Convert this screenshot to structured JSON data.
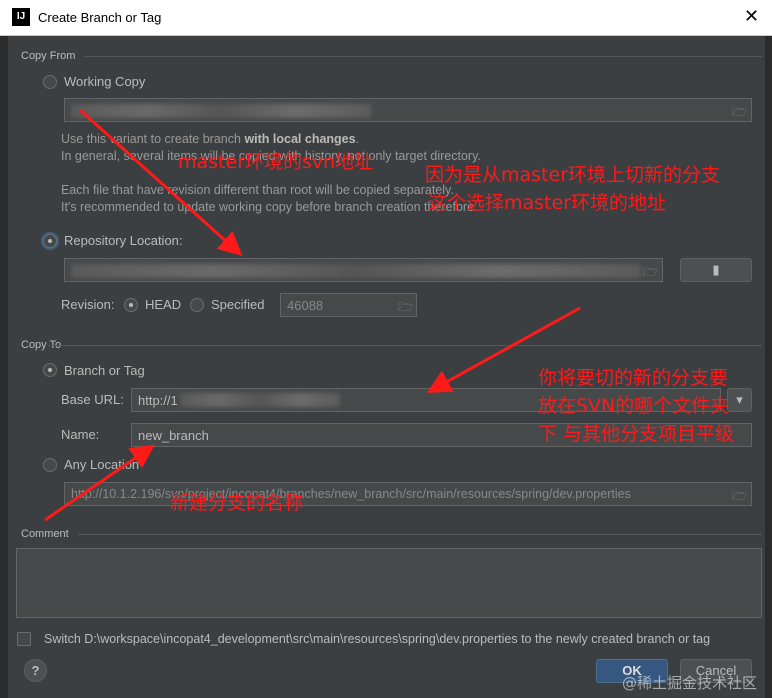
{
  "window": {
    "title": "Create Branch or Tag",
    "app_icon": "IJ"
  },
  "copy_from": {
    "section": "Copy From",
    "working_copy_label": "Working Copy",
    "hint_lines": [
      {
        "pre": "Use this variant to create branch ",
        "bold": "with local changes",
        "post": "."
      },
      {
        "pre": "In general, several items will be copied with history, not only target directory.",
        "bold": "",
        "post": ""
      },
      {
        "pre": "Each file that have revision different than root will be copied separately.",
        "bold": "",
        "post": ""
      },
      {
        "pre": "It's recommended to update working copy before branch creation therefore.",
        "bold": "",
        "post": ""
      }
    ],
    "repository_location_label": "Repository Location:",
    "revision_label": "Revision:",
    "head_label": "HEAD",
    "specified_label": "Specified",
    "revision_value": "46088"
  },
  "copy_to": {
    "section": "Copy To",
    "branch_or_tag_label": "Branch or Tag",
    "base_url_label": "Base URL:",
    "base_url_value": "http://1",
    "name_label": "Name:",
    "name_value": "new_branch",
    "any_location_label": "Any Location",
    "any_location_value": "http://10.1.2.196/svn/project/incopat4/branches/new_branch/src/main/resources/spring/dev.properties"
  },
  "comment": {
    "section": "Comment",
    "value": ""
  },
  "switch_checkbox": {
    "label": "Switch D:\\workspace\\incopat4_development\\src\\main\\resources\\spring\\dev.properties to the newly created branch or tag",
    "checked": false
  },
  "buttons": {
    "help": "?",
    "ok": "OK",
    "cancel": "Cancel"
  },
  "annotations": {
    "svn_address": "master环境的svn地址",
    "reason_1": "因为是从master环境上切新的分支",
    "reason_2": "这个选择master环境的地址",
    "target_1": "你将要切的新的分支要",
    "target_2": "放在SVN的哪个文件夹",
    "target_3": "下 与其他分支项目平级",
    "branch_name": "新建分支的名称"
  },
  "watermark": "@稀土掘金技术社区",
  "colors": {
    "annotation": "#ff1a1a",
    "ok_button": "#365880",
    "dialog_bg": "#3c3f41"
  }
}
